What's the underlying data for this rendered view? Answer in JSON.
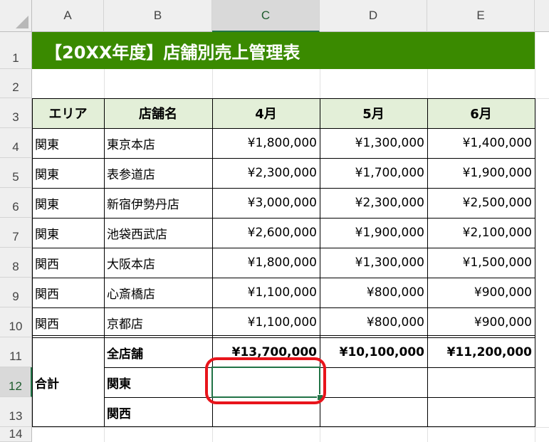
{
  "columns": [
    "A",
    "B",
    "C",
    "D",
    "E"
  ],
  "rows": [
    "1",
    "2",
    "3",
    "4",
    "5",
    "6",
    "7",
    "8",
    "9",
    "10",
    "11",
    "12",
    "13",
    "14"
  ],
  "title": "【20XX年度】店舗別売上管理表",
  "headers": {
    "area": "エリア",
    "store": "店舗名",
    "m4": "4月",
    "m5": "5月",
    "m6": "6月"
  },
  "data": [
    {
      "area": "関東",
      "store": "東京本店",
      "m4": "¥1,800,000",
      "m5": "¥1,300,000",
      "m6": "¥1,400,000"
    },
    {
      "area": "関東",
      "store": "表参道店",
      "m4": "¥2,300,000",
      "m5": "¥1,700,000",
      "m6": "¥1,900,000"
    },
    {
      "area": "関東",
      "store": "新宿伊勢丹店",
      "m4": "¥3,000,000",
      "m5": "¥2,300,000",
      "m6": "¥2,500,000"
    },
    {
      "area": "関東",
      "store": "池袋西武店",
      "m4": "¥2,600,000",
      "m5": "¥1,900,000",
      "m6": "¥2,100,000"
    },
    {
      "area": "関西",
      "store": "大阪本店",
      "m4": "¥1,800,000",
      "m5": "¥1,300,000",
      "m6": "¥1,500,000"
    },
    {
      "area": "関西",
      "store": "心斎橋店",
      "m4": "¥1,100,000",
      "m5": "¥800,000",
      "m6": "¥900,000"
    },
    {
      "area": "関西",
      "store": "京都店",
      "m4": "¥1,100,000",
      "m5": "¥800,000",
      "m6": "¥900,000"
    }
  ],
  "totals": {
    "label": "合計",
    "all_label": "全店舗",
    "all_m4": "¥13,700,000",
    "all_m5": "¥10,100,000",
    "all_m6": "¥11,200,000",
    "kanto_label": "関東",
    "kansai_label": "関西"
  },
  "colors": {
    "title_bg": "#3a8a00",
    "header_bg": "#e3efd8",
    "selection": "#217346",
    "callout": "#e8141b"
  }
}
